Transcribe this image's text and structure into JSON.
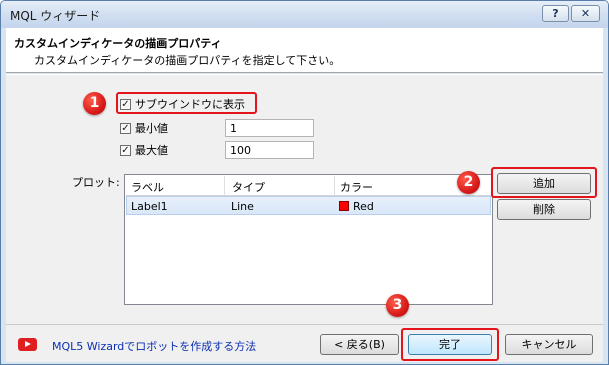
{
  "window": {
    "title": "MQL ウィザード",
    "help_glyph": "?",
    "close_glyph": "✕"
  },
  "header": {
    "title": "カスタムインディケータの描画プロパティ",
    "subtitle": "カスタムインディケータの描画プロパティを指定して下さい。"
  },
  "options": {
    "separate_window": {
      "label": "サブウインドウに表示",
      "checked": true
    },
    "minimum": {
      "label": "最小値",
      "checked": true,
      "value": "1"
    },
    "maximum": {
      "label": "最大値",
      "checked": true,
      "value": "100"
    }
  },
  "plots": {
    "label": "プロット:",
    "columns": [
      "ラベル",
      "タイプ",
      "カラー"
    ],
    "rows": [
      {
        "label": "Label1",
        "type": "Line",
        "color_name": "Red",
        "color_hex": "#ff0000"
      }
    ],
    "add_label": "追加",
    "delete_label": "削除"
  },
  "footer": {
    "link_text": "MQL5 Wizardでロボットを作成する方法",
    "back_label": "< 戻る(B)",
    "finish_label": "完了",
    "cancel_label": "キャンセル"
  },
  "callouts": [
    "1",
    "2",
    "3"
  ],
  "colors": {
    "callout_red": "#e4141c",
    "link_blue": "#0c2fb0",
    "title_bar": "#d0def0"
  },
  "icons": [
    "youtube-icon",
    "checkbox-checked-icon"
  ]
}
